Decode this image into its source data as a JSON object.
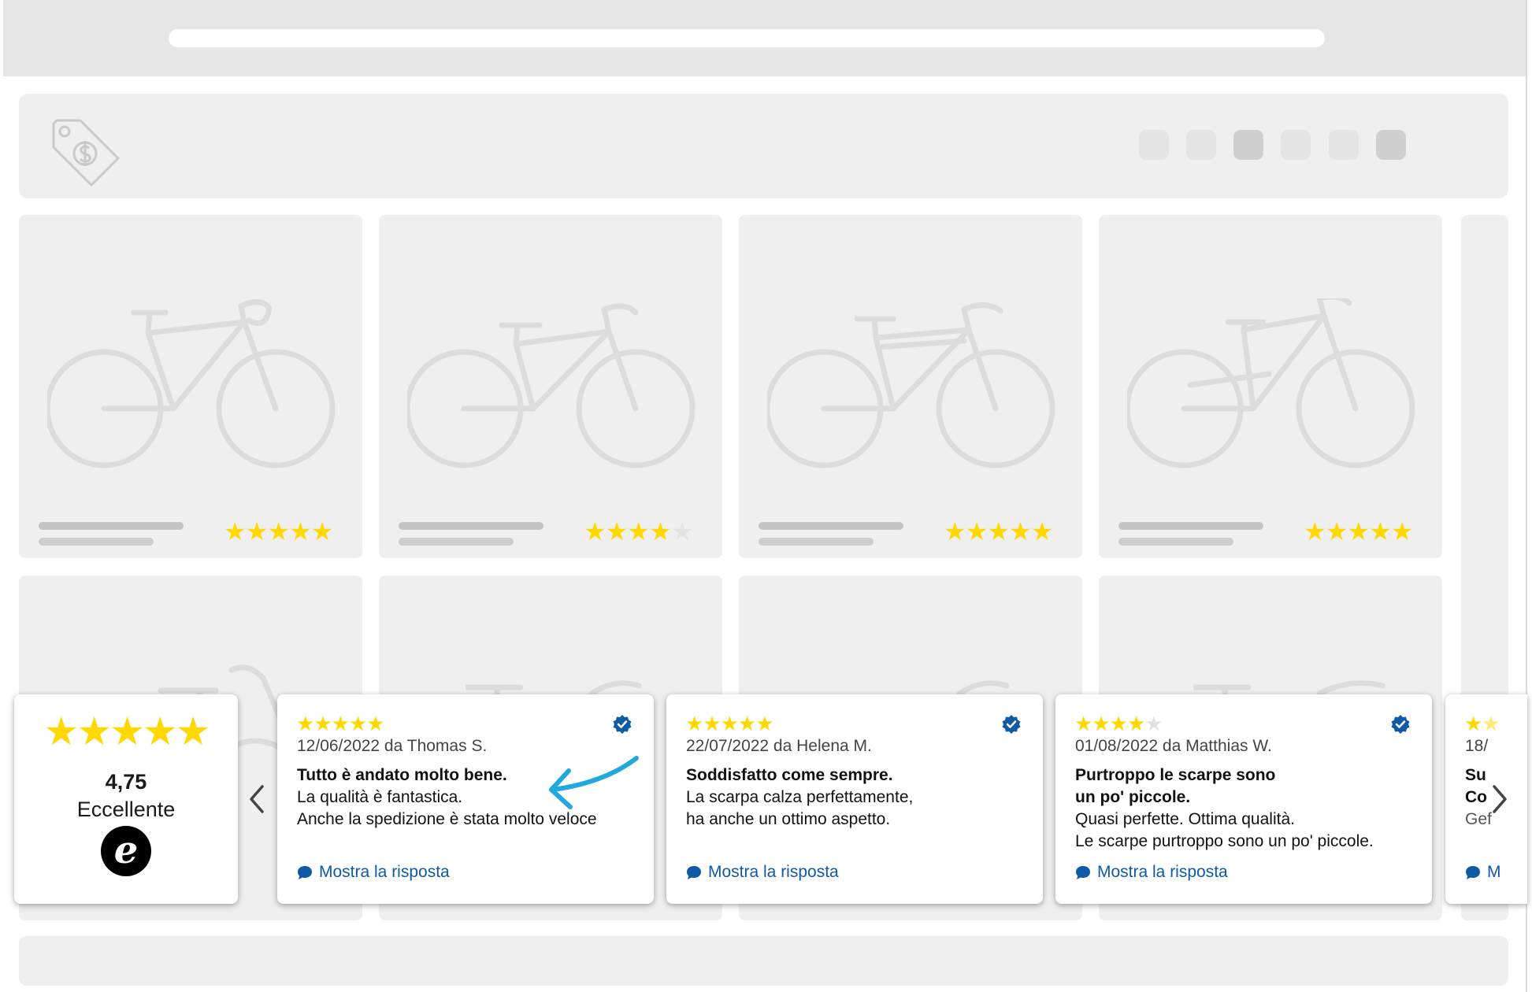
{
  "summary": {
    "score": "4,75",
    "label": "Eccellente",
    "logo_letter": "e",
    "stars": 5
  },
  "product_ratings": [
    5,
    4,
    5,
    5
  ],
  "reviews": [
    {
      "stars": 5,
      "meta": "12/06/2022 da Thomas S.",
      "title_lines": [
        "Tutto è andato molto bene."
      ],
      "body_lines": [
        "La qualità è fantastica.",
        "Anche la spedizione è stata molto veloce"
      ],
      "reply": "Mostra la risposta"
    },
    {
      "stars": 5,
      "meta": "22/07/2022 da Helena M.",
      "title_lines": [
        "Soddisfatto come sempre."
      ],
      "body_lines": [
        "La scarpa calza perfettamente,",
        "ha anche un ottimo aspetto."
      ],
      "reply": "Mostra la risposta"
    },
    {
      "stars": 4,
      "meta": "01/08/2022 da Matthias W.",
      "title_lines": [
        "Purtroppo le scarpe sono",
        "un po' piccole."
      ],
      "body_lines": [
        "Quasi perfette. Ottima qualità.",
        "Le scarpe purtroppo sono un po' piccole."
      ],
      "reply": "Mostra la risposta"
    }
  ],
  "partial_review": {
    "stars": 2,
    "meta": "18/",
    "title_lines": [
      "Su",
      "Co"
    ],
    "body_lines": [
      "Gef"
    ],
    "reply": "M"
  },
  "colors": {
    "star": "#ffd800",
    "link": "#0d5aa7",
    "verified": "#0d5aa7",
    "annotation_arrow": "#21a9dd"
  },
  "icons": {
    "header": "price-tag-icon",
    "prev": "chevron-left-icon",
    "next": "chevron-right-icon",
    "verified": "verified-badge-icon",
    "reply": "speech-bubble-icon"
  }
}
